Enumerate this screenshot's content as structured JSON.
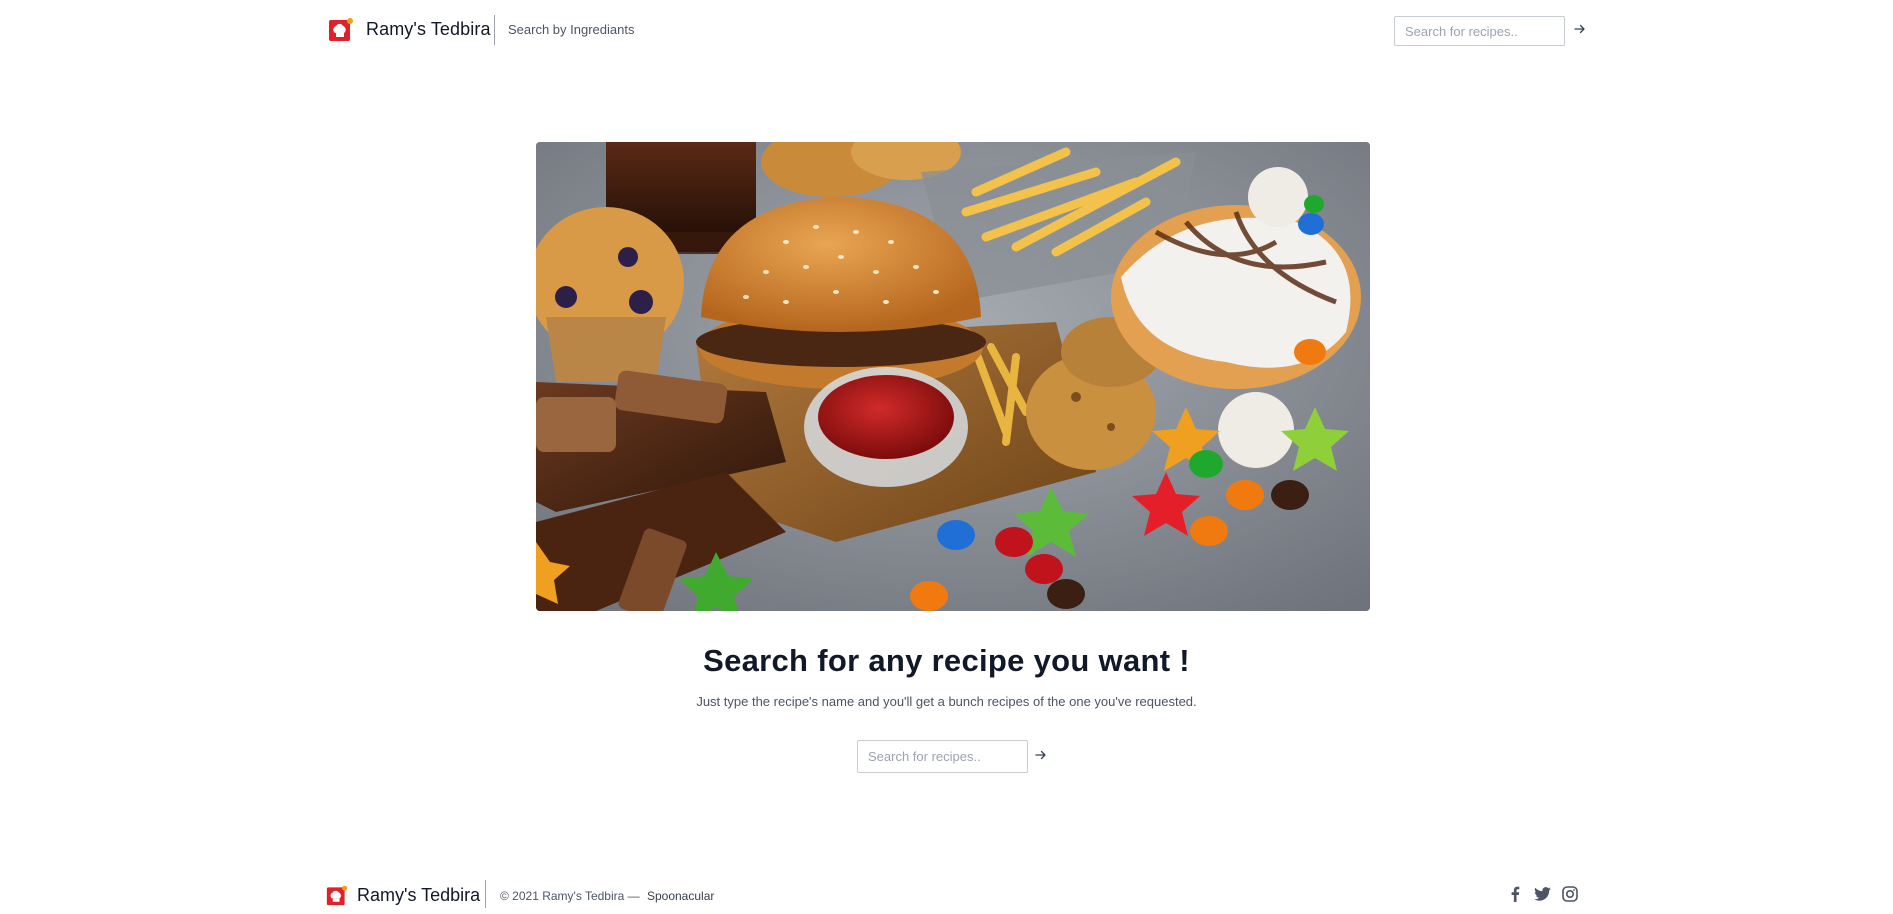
{
  "header": {
    "brand": "Ramy's Tedbira",
    "nav_link": "Search by Ingrediants",
    "search_placeholder": "Search for recipes.."
  },
  "hero": {
    "headline": "Search for any recipe you want !",
    "subline": "Just type the recipe's name and you'll get a bunch recipes of the one you've requested.",
    "search_placeholder": "Search for recipes.."
  },
  "footer": {
    "brand": "Ramy's Tedbira",
    "copyright": "© 2021 Ramy's Tedbira —",
    "api_link": "Spoonacular",
    "social": [
      "facebook-icon",
      "twitter-icon",
      "instagram-icon"
    ]
  },
  "colors": {
    "logo_red": "#e0202a",
    "text_dark": "#111827",
    "text_muted": "#4b5563",
    "border": "#c7ccd3"
  }
}
